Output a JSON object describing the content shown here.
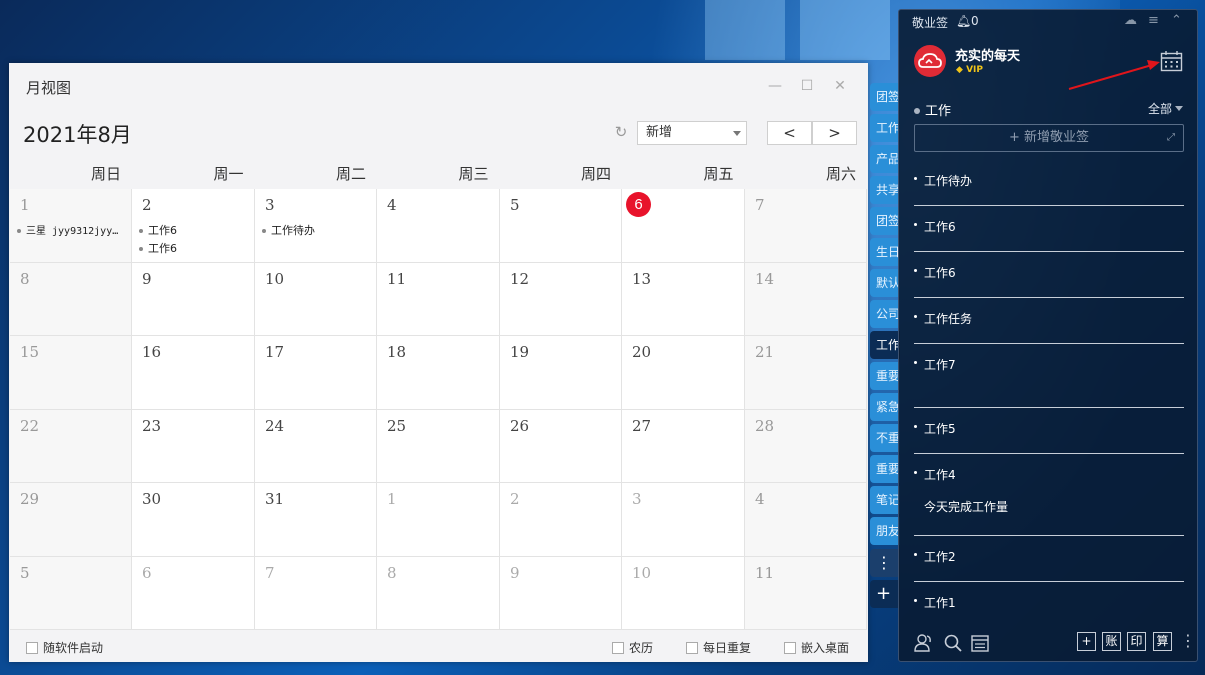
{
  "calendar": {
    "window_title": "月视图",
    "month_title": "2021年8月",
    "add_select_value": "新增",
    "prev_label": "<",
    "next_label": ">",
    "weekdays": [
      "周日",
      "周一",
      "周二",
      "周三",
      "周四",
      "周五",
      "周六"
    ],
    "rows": [
      [
        {
          "day": "1",
          "dim": false,
          "events": [
            "三星 jyy9312jyy…"
          ]
        },
        {
          "day": "2",
          "dim": false,
          "events": [
            "工作6",
            "工作6"
          ]
        },
        {
          "day": "3",
          "dim": false,
          "events": [
            "工作待办"
          ]
        },
        {
          "day": "4",
          "dim": false,
          "events": []
        },
        {
          "day": "5",
          "dim": false,
          "events": []
        },
        {
          "day": "6",
          "dim": false,
          "today": true,
          "events": []
        },
        {
          "day": "7",
          "dim": false,
          "events": []
        }
      ],
      [
        {
          "day": "8"
        },
        {
          "day": "9"
        },
        {
          "day": "10"
        },
        {
          "day": "11"
        },
        {
          "day": "12"
        },
        {
          "day": "13"
        },
        {
          "day": "14"
        }
      ],
      [
        {
          "day": "15"
        },
        {
          "day": "16"
        },
        {
          "day": "17"
        },
        {
          "day": "18"
        },
        {
          "day": "19"
        },
        {
          "day": "20"
        },
        {
          "day": "21"
        }
      ],
      [
        {
          "day": "22"
        },
        {
          "day": "23"
        },
        {
          "day": "24"
        },
        {
          "day": "25"
        },
        {
          "day": "26"
        },
        {
          "day": "27"
        },
        {
          "day": "28"
        }
      ],
      [
        {
          "day": "29"
        },
        {
          "day": "30"
        },
        {
          "day": "31"
        },
        {
          "day": "1",
          "dim": true
        },
        {
          "day": "2",
          "dim": true
        },
        {
          "day": "3",
          "dim": true
        },
        {
          "day": "4",
          "dim": true
        }
      ],
      [
        {
          "day": "5",
          "dim": true
        },
        {
          "day": "6",
          "dim": true
        },
        {
          "day": "7",
          "dim": true
        },
        {
          "day": "8",
          "dim": true
        },
        {
          "day": "9",
          "dim": true
        },
        {
          "day": "10",
          "dim": true
        },
        {
          "day": "11",
          "dim": true
        }
      ]
    ],
    "footer": {
      "autostart": "随软件启动",
      "lunar": "农历",
      "daily_repeat": "每日重复",
      "embed_desktop": "嵌入桌面"
    }
  },
  "side_tabs": [
    {
      "label": "团签"
    },
    {
      "label": "工作"
    },
    {
      "label": "产品"
    },
    {
      "label": "共享"
    },
    {
      "label": "团签"
    },
    {
      "label": "生日"
    },
    {
      "label": "默认"
    },
    {
      "label": "公司"
    },
    {
      "label": "工作",
      "active": true
    },
    {
      "label": "重要"
    },
    {
      "label": "紧急"
    },
    {
      "label": "不重"
    },
    {
      "label": "重要"
    },
    {
      "label": "笔记"
    },
    {
      "label": "朋友"
    }
  ],
  "side_more": "⋮",
  "side_plus": "+",
  "notes": {
    "app_name": "敬业签",
    "notification_count": "0",
    "user_name": "充实的每天",
    "vip": "VIP",
    "category": "工作",
    "filter": "全部",
    "add_placeholder": "+ 新增敬业签",
    "items": [
      {
        "title": "工作待办",
        "sub": ""
      },
      {
        "title": "工作6",
        "sub": ""
      },
      {
        "title": "工作6",
        "sub": ""
      },
      {
        "title": "工作任务",
        "sub": ""
      },
      {
        "title": "工作7",
        "sub": ""
      },
      {
        "title": "工作5",
        "sub": ""
      },
      {
        "title": "工作4",
        "sub": "今天完成工作量"
      },
      {
        "title": "工作2",
        "sub": ""
      },
      {
        "title": "工作1",
        "sub": ""
      }
    ],
    "bottom_buttons": [
      "+",
      "账",
      "印",
      "算"
    ]
  },
  "colors": {
    "today": "#e8132b",
    "tab_blue": "#2a8fd8",
    "panel_bg": "#091c34",
    "annotation_arrow": "#e0151b"
  }
}
